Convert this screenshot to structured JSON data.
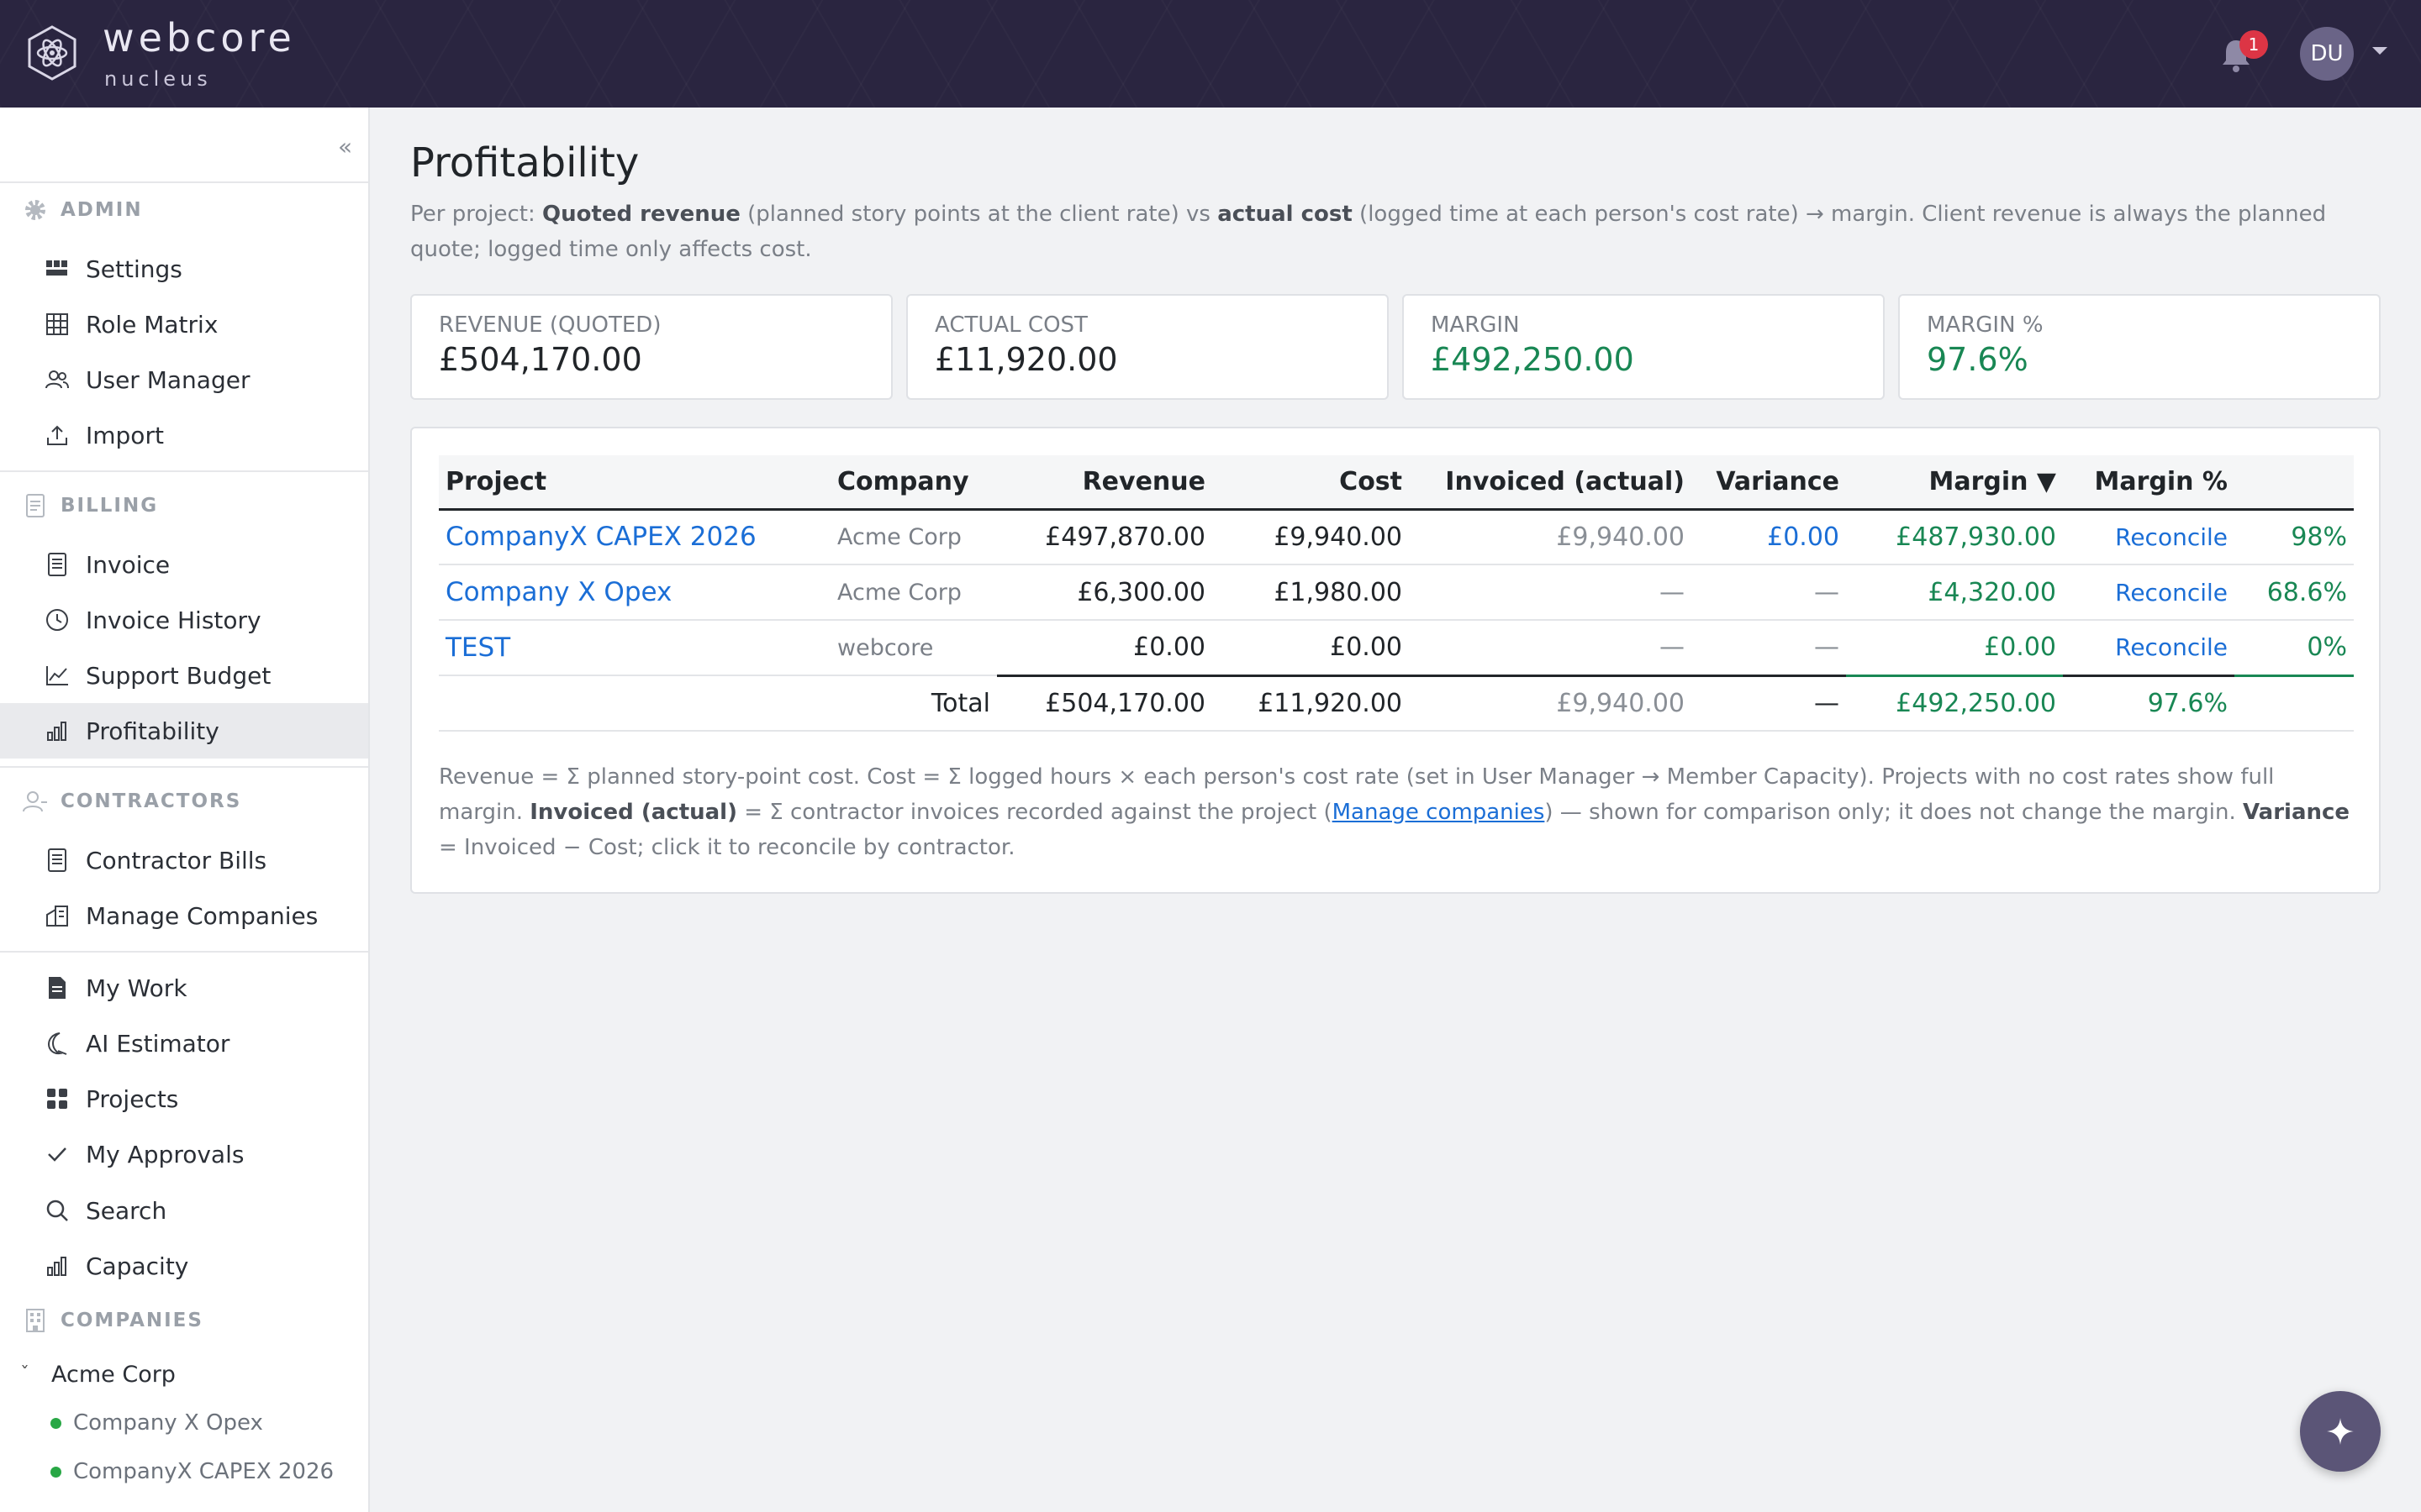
{
  "brand": {
    "name": "webcore",
    "sub": "nucleus",
    "logo_icon": "atom-icon"
  },
  "topbar": {
    "notifications_count": "1",
    "avatar_initials": "DU"
  },
  "sidebar": {
    "sections": {
      "admin": "ADMIN",
      "billing": "BILLING",
      "contractors": "CONTRACTORS",
      "companies": "COMPANIES"
    },
    "admin_items": [
      "Settings",
      "Role Matrix",
      "User Manager",
      "Import"
    ],
    "billing_items": [
      "Invoice",
      "Invoice History",
      "Support Budget",
      "Profitability"
    ],
    "contractor_items": [
      "Contractor Bills",
      "Manage Companies"
    ],
    "general_items": [
      "My Work",
      "AI Estimator",
      "Projects",
      "My Approvals",
      "Search",
      "Capacity"
    ],
    "company": {
      "name": "Acme Corp",
      "children": [
        "Company X Opex",
        "CompanyX CAPEX 2026"
      ]
    },
    "active_item": "Profitability"
  },
  "page": {
    "title": "Profitability",
    "desc": {
      "p1": "Per project: ",
      "b1": "Quoted revenue",
      "p2": " (planned story points at the client rate) vs ",
      "b2": "actual cost",
      "p3": " (logged time at each person's cost rate) → margin. Client revenue is always the planned quote; logged time only affects cost."
    }
  },
  "summary": {
    "revenue_label": "REVENUE (QUOTED)",
    "revenue_value": "£504,170.00",
    "cost_label": "ACTUAL COST",
    "cost_value": "£11,920.00",
    "margin_label": "MARGIN",
    "margin_value": "£492,250.00",
    "margin_pct_label": "MARGIN %",
    "margin_pct_value": "97.6%"
  },
  "table": {
    "headers": {
      "project": "Project",
      "company": "Company",
      "revenue": "Revenue",
      "cost": "Cost",
      "invoiced": "Invoiced (actual)",
      "variance": "Variance",
      "margin": "Margin ▼",
      "margin_pct": "Margin %"
    },
    "rows": [
      {
        "project": "CompanyX CAPEX 2026",
        "company": "Acme Corp",
        "revenue": "£497,870.00",
        "cost": "£9,940.00",
        "invoiced": "£9,940.00",
        "variance": "£0.00",
        "margin": "£487,930.00",
        "action": "Reconcile",
        "margin_pct": "98%"
      },
      {
        "project": "Company X Opex",
        "company": "Acme Corp",
        "revenue": "£6,300.00",
        "cost": "£1,980.00",
        "invoiced": "—",
        "variance": "—",
        "margin": "£4,320.00",
        "action": "Reconcile",
        "margin_pct": "68.6%"
      },
      {
        "project": "TEST",
        "company": "webcore",
        "revenue": "£0.00",
        "cost": "£0.00",
        "invoiced": "—",
        "variance": "—",
        "margin": "£0.00",
        "action": "Reconcile",
        "margin_pct": "0%"
      }
    ],
    "total": {
      "label": "Total",
      "revenue": "£504,170.00",
      "cost": "£11,920.00",
      "invoiced": "£9,940.00",
      "variance": "—",
      "margin": "£492,250.00",
      "margin_pct": "97.6%"
    }
  },
  "note": {
    "p1": "Revenue = Σ planned story-point cost. Cost = Σ logged hours × each person's cost rate (set in User Manager → Member Capacity). Projects with no cost rates show full margin. ",
    "b1": "Invoiced (actual)",
    "p2": " = Σ contractor invoices recorded against the project (",
    "link": "Manage companies",
    "p3": ") — shown for comparison only; it does not change the margin. ",
    "b2": "Variance",
    "p4": " = Invoiced − Cost; click it to reconcile by contractor."
  },
  "colors": {
    "topbar": "#2a2540",
    "accent_link": "#1b6ed6",
    "positive": "#198754",
    "badge": "#dc3545"
  }
}
